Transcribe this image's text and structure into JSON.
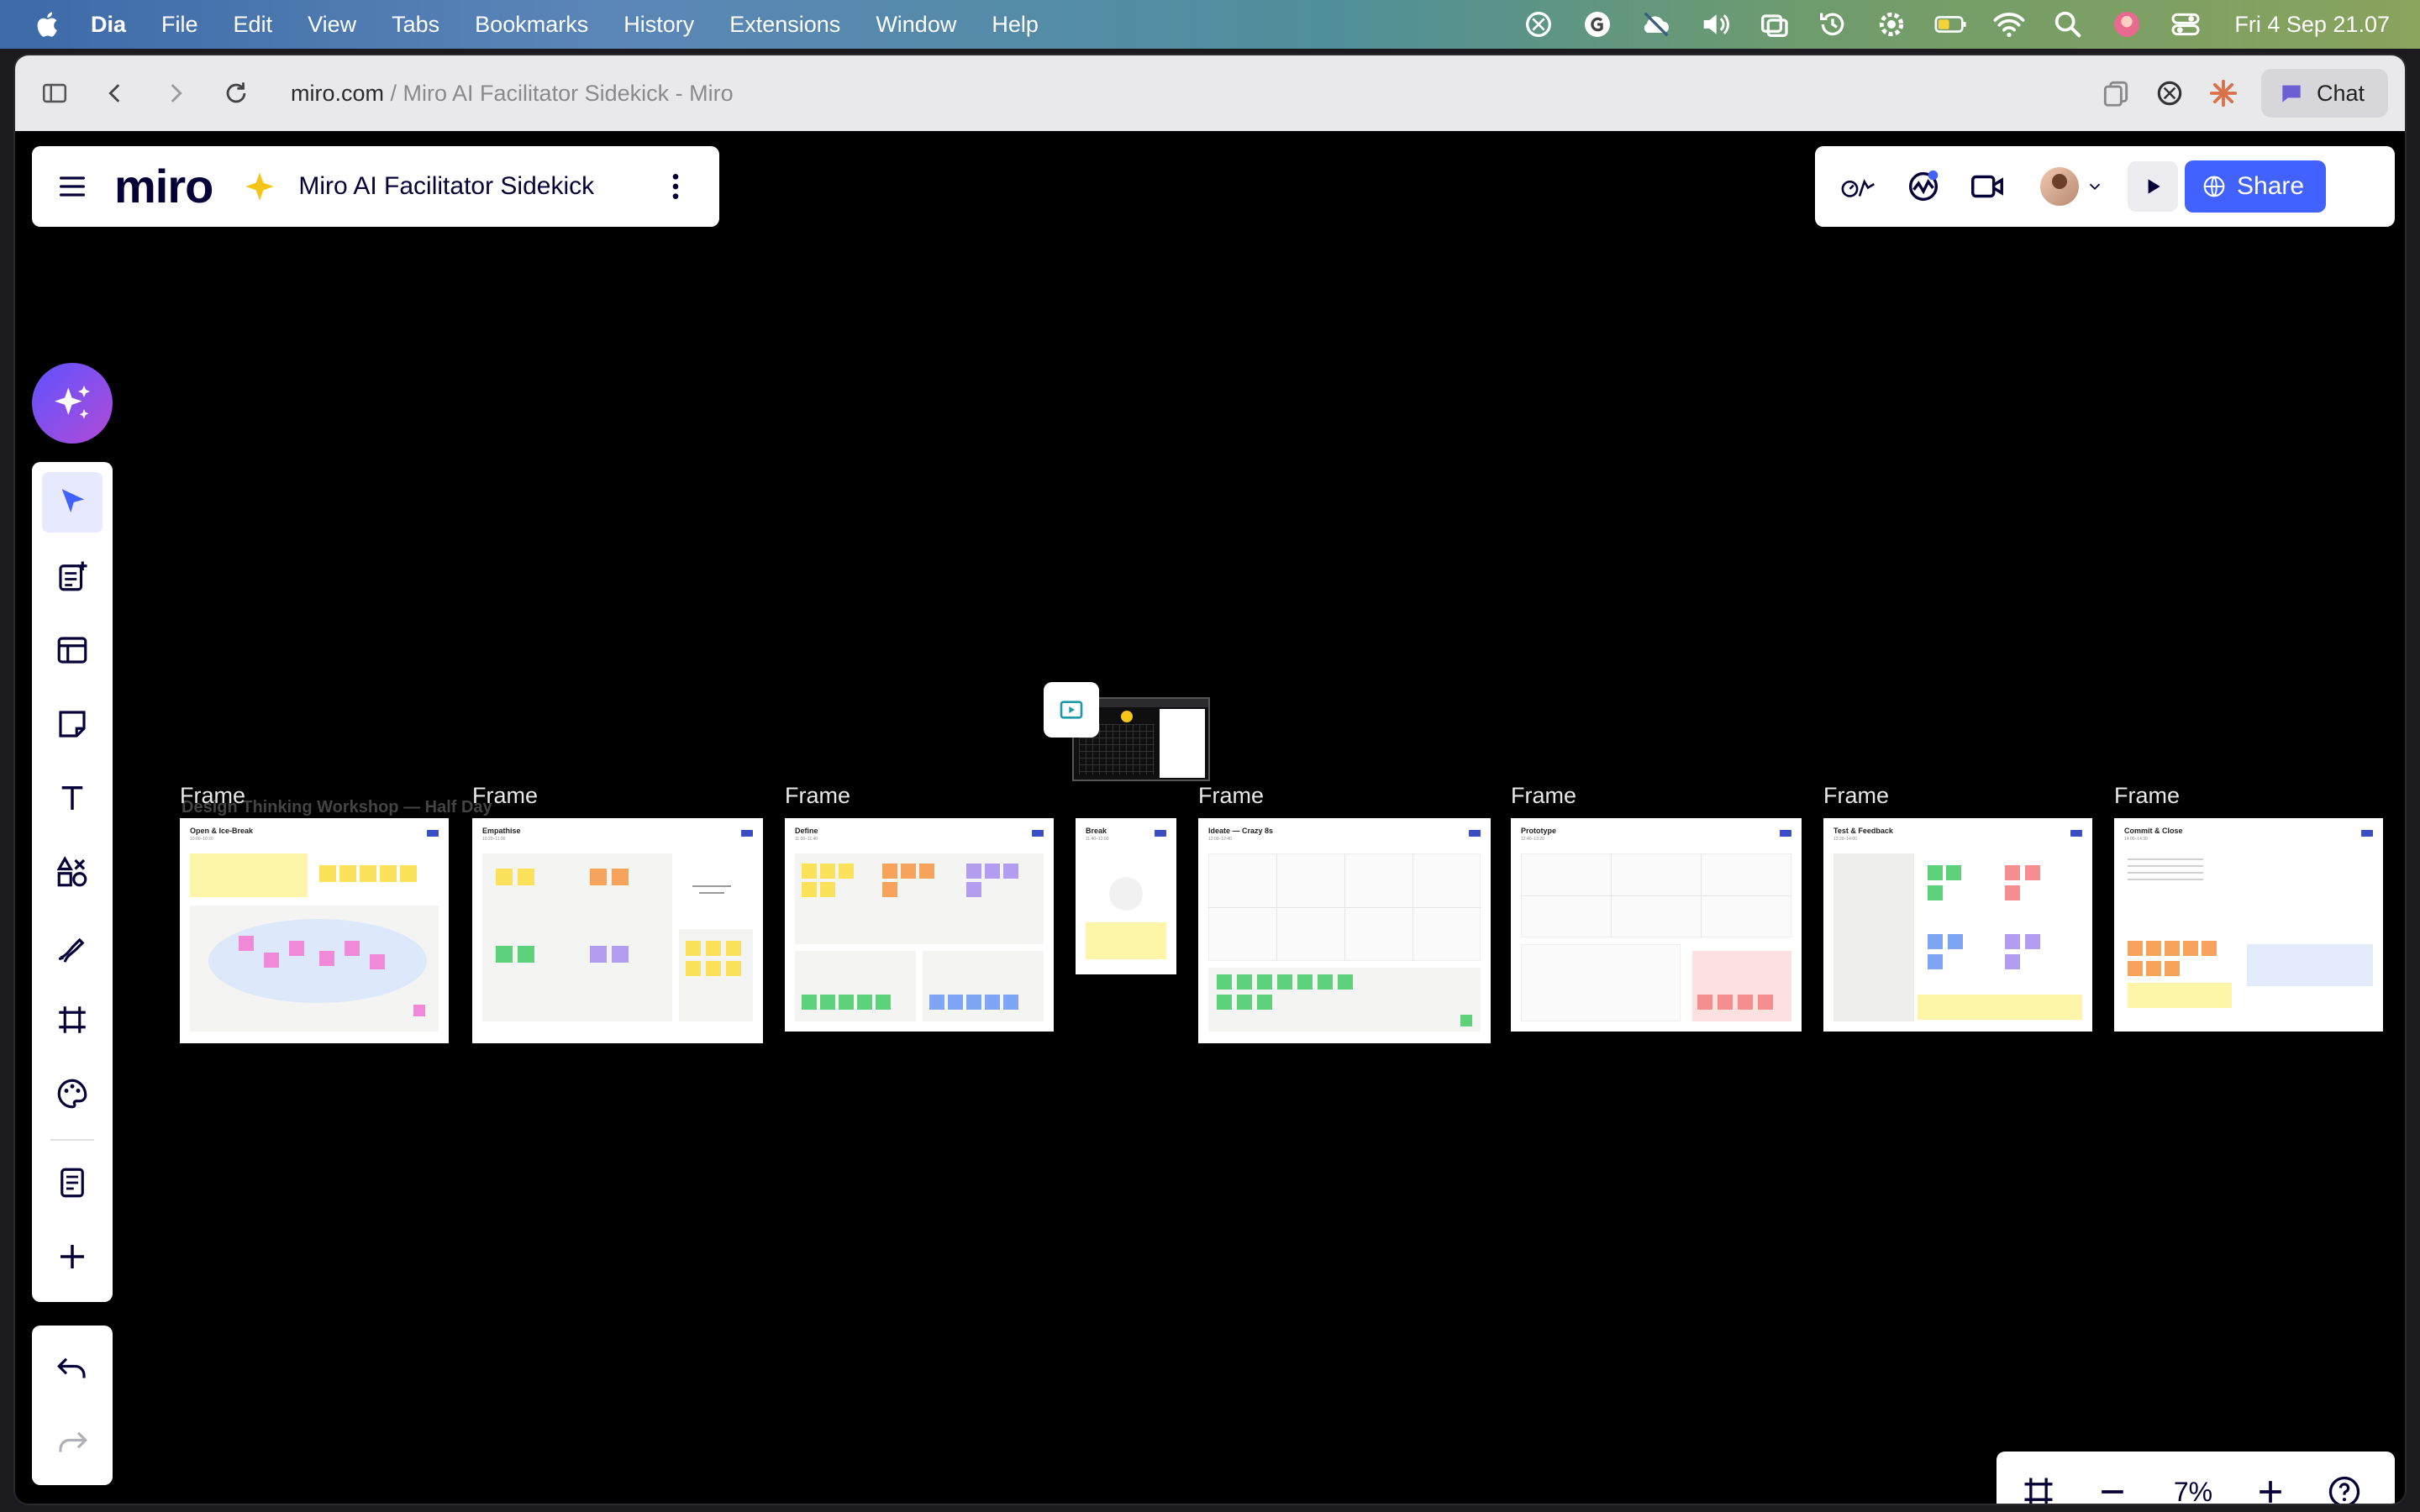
{
  "menubar": {
    "app_name": "Dia",
    "items": [
      "File",
      "Edit",
      "View",
      "Tabs",
      "Bookmarks",
      "History",
      "Extensions",
      "Window",
      "Help"
    ],
    "clock": "Fri 4 Sep  21.07"
  },
  "browser": {
    "url_domain": "miro.com",
    "url_rest": " / Miro AI Facilitator Sidekick - Miro",
    "chat_label": "Chat"
  },
  "board": {
    "logo": "miro",
    "title": "Miro AI Facilitator Sidekick",
    "share_label": "Share",
    "zoom": "7%",
    "ghost_title": "Design Thinking Workshop — Half Day"
  },
  "frames": [
    {
      "label": "Frame",
      "title": "Open & Ice-Break",
      "sub": "10:00–10:20"
    },
    {
      "label": "Frame",
      "title": "Empathise",
      "sub": "10:20–11:00"
    },
    {
      "label": "Frame",
      "title": "Define",
      "sub": "11:00–11:40"
    },
    {
      "label": "",
      "title": "Break",
      "sub": "11:40–12:00"
    },
    {
      "label": "Frame",
      "title": "Ideate — Crazy 8s",
      "sub": "12:00–12:40"
    },
    {
      "label": "Frame",
      "title": "Prototype",
      "sub": "12:40–13:20"
    },
    {
      "label": "Frame",
      "title": "Test & Feedback",
      "sub": "13:20–14:00"
    },
    {
      "label": "Frame",
      "title": "Commit & Close",
      "sub": "14:00–14:30"
    }
  ],
  "colors": {
    "accent": "#4262ff",
    "sticky_yellow": "#fce25a",
    "sticky_orange": "#f7a35c",
    "sticky_purple": "#b39df0",
    "sticky_green": "#5ed17b",
    "sticky_pink": "#f08ad8",
    "sticky_red": "#f58f8f",
    "sticky_blue": "#7ea6f5"
  }
}
